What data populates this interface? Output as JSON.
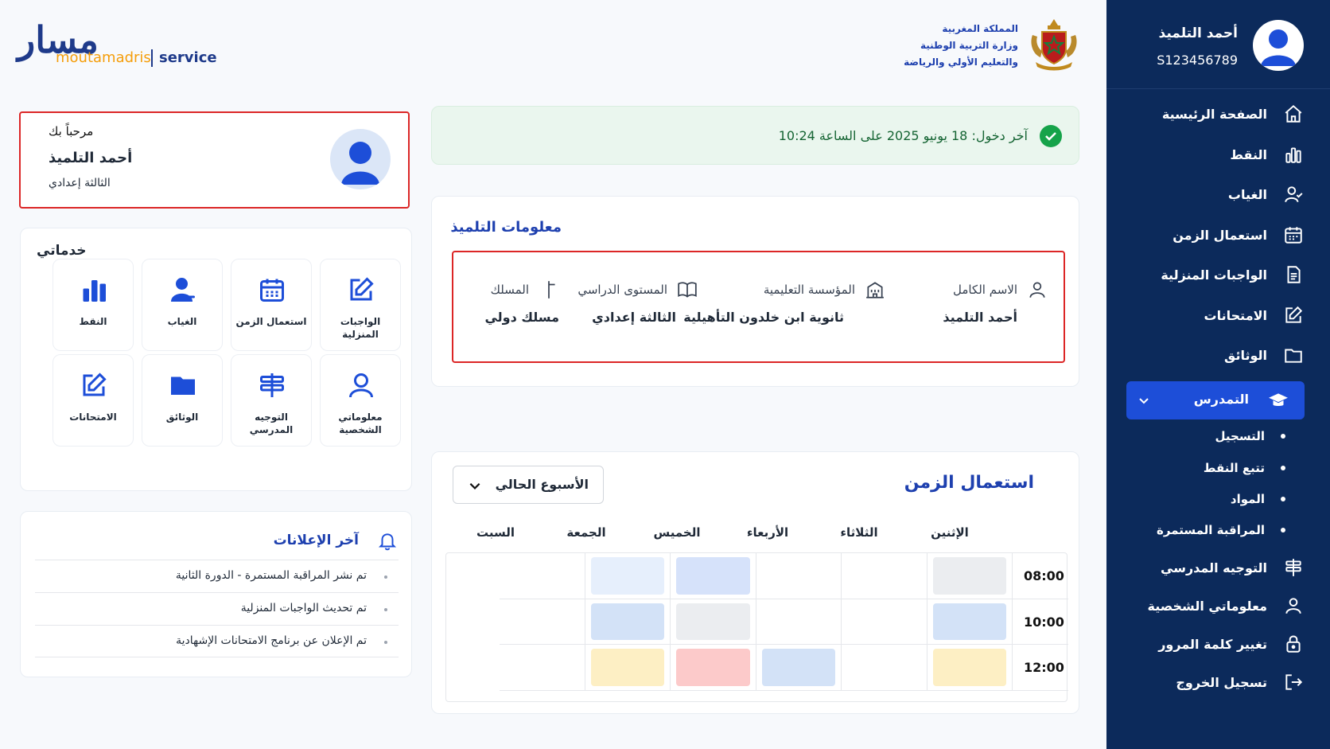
{
  "brand": {
    "logo_ar": "مسار",
    "logo_en": "moutamadris",
    "logo_service": "service",
    "ministry_lines": [
      "المملكة المغربية",
      "وزارة التربية الوطنية",
      "والتعليم الأولي والرياضة"
    ]
  },
  "user": {
    "name": "أحمد التلميذ",
    "id": "S123456789",
    "welcome": "مرحباً بك",
    "level": "الثالثة إعدادي"
  },
  "sidebar": {
    "items": [
      {
        "label": "الصفحة الرئيسية",
        "icon": "home-icon"
      },
      {
        "label": "النقط",
        "icon": "bar-chart-icon"
      },
      {
        "label": "الغياب",
        "icon": "user-check-icon"
      },
      {
        "label": "استعمال الزمن",
        "icon": "calendar-icon"
      },
      {
        "label": "الواجبات المنزلية",
        "icon": "document-icon"
      },
      {
        "label": "الامتحانات",
        "icon": "edit-icon"
      },
      {
        "label": "الوثائق",
        "icon": "folder-icon"
      }
    ],
    "active": {
      "label": "التمدرس",
      "icon": "graduation-cap-icon"
    },
    "sub_items": [
      "التسجيل",
      "تتبع النقط",
      "المواد",
      "المراقبة المستمرة"
    ],
    "bottom_items": [
      {
        "label": "التوجيه المدرسي",
        "icon": "signpost-icon"
      },
      {
        "label": "معلوماتي الشخصية",
        "icon": "user-icon"
      },
      {
        "label": "تغيير كلمة المرور",
        "icon": "lock-icon"
      },
      {
        "label": "تسجيل الخروج",
        "icon": "logout-icon"
      }
    ]
  },
  "last_login": {
    "text": "آخر دخول: 18 يونيو 2025 على الساعة 10:24"
  },
  "services": {
    "title": "خدماتي",
    "tiles": [
      {
        "label": "الواجبات المنزلية",
        "icon": "homework-icon"
      },
      {
        "label": "استعمال الزمن",
        "icon": "calendar-icon"
      },
      {
        "label": "الغياب",
        "icon": "person-icon"
      },
      {
        "label": "النقط",
        "icon": "bar-chart-icon"
      },
      {
        "label": "معلوماتي الشخصية",
        "icon": "user-icon"
      },
      {
        "label": "التوجيه المدرسي",
        "icon": "signpost-icon"
      },
      {
        "label": "الوثائق",
        "icon": "folder-icon"
      },
      {
        "label": "الامتحانات",
        "icon": "exam-edit-icon"
      }
    ]
  },
  "student_info": {
    "title": "معلومات التلميذ",
    "fields": [
      {
        "label": "الاسم الكامل",
        "value": "أحمد التلميذ",
        "icon": "user-icon"
      },
      {
        "label": "المؤسسة التعليمية",
        "value": "ثانوية ابن خلدون التأهيلية",
        "icon": "school-icon"
      },
      {
        "label": "المستوى الدراسي",
        "value": "الثالثة إعدادي",
        "icon": "book-icon"
      },
      {
        "label": "المسلك",
        "value": "مسلك دولي",
        "icon": "track-icon"
      }
    ]
  },
  "announcements": {
    "title": "آخر الإعلانات",
    "items": [
      "تم نشر المراقبة المستمرة - الدورة الثانية",
      "تم تحديث الواجبات المنزلية",
      "تم الإعلان عن برنامج الامتحانات الإشهادية"
    ]
  },
  "timetable": {
    "title": "استعمال الزمن",
    "week_select": "الأسبوع الحالي",
    "days": [
      "الإثنين",
      "الثلاثاء",
      "الأربعاء",
      "الخميس",
      "الجمعة",
      "السبت"
    ],
    "times": [
      "08:00",
      "10:00",
      "12:00"
    ],
    "cells": [
      [
        "gray",
        "",
        "",
        "blue-light",
        "blue-pale",
        ""
      ],
      [
        "blue",
        "",
        "",
        "gray",
        "blue",
        ""
      ],
      [
        "yellow",
        "",
        "blue",
        "red",
        "yellow",
        ""
      ]
    ],
    "colors": {
      "gray": "#ebedf0",
      "blue-light": "#d6e2fa",
      "blue-pale": "#e6effc",
      "blue": "#d3e2f7",
      "red": "#fccaca",
      "yellow": "#fdefc4"
    }
  }
}
